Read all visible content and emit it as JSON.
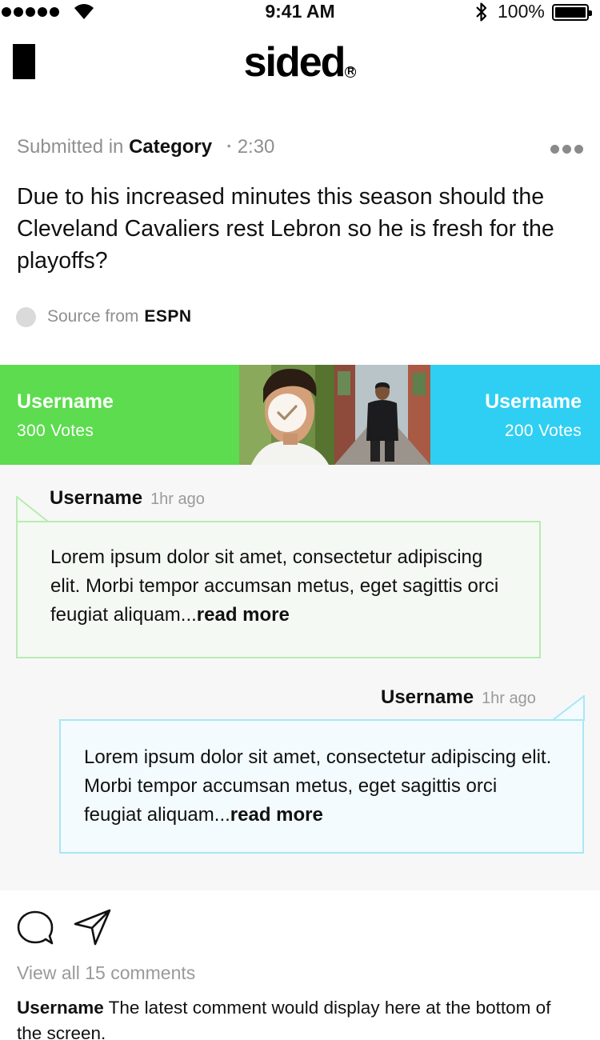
{
  "status_bar": {
    "time": "9:41 AM",
    "battery": "100%",
    "icons": [
      "signal-dots-icon",
      "wifi-icon",
      "bluetooth-icon",
      "battery-icon"
    ]
  },
  "header": {
    "logo": "sided",
    "logo_mark": "R",
    "menu_icon": "menu-block-icon"
  },
  "post": {
    "submitted_prefix": "Submitted in",
    "category": "Category",
    "bullet": "•",
    "duration": "2:30",
    "question": "Due to his increased minutes this season should the Cleveland Cavaliers rest Lebron so he is fresh for the playoffs?",
    "source_prefix": "Source from",
    "source_name": "ESPN",
    "more_icon": "more-dots-icon"
  },
  "vote": {
    "left": {
      "username": "Username",
      "votes": "300 Votes",
      "color": "#5cdc4e"
    },
    "right": {
      "username": "Username",
      "votes": "200 Votes",
      "color": "#2ecff2"
    },
    "selected_icon": "checkmark-icon"
  },
  "comments": [
    {
      "username": "Username",
      "ago": "1hr ago",
      "text": "Lorem ipsum dolor sit amet, consectetur adipiscing elit. Morbi tempor accumsan metus, eget sagittis orci feugiat aliquam...",
      "read_more": "read more",
      "color": "#b7ecb1"
    },
    {
      "username": "Username",
      "ago": "1hr ago",
      "text": "Lorem ipsum dolor sit amet, consectetur adipiscing elit. Morbi tempor accumsan metus, eget sagittis orci feugiat aliquam...",
      "read_more": "read more",
      "color": "#a8e7f7"
    }
  ],
  "footer": {
    "view_all": "View all 15 comments",
    "latest_username": "Username",
    "latest_text": " The latest comment would display here at the bottom of the screen.",
    "icons": [
      "comment-bubble-icon",
      "send-icon"
    ]
  }
}
